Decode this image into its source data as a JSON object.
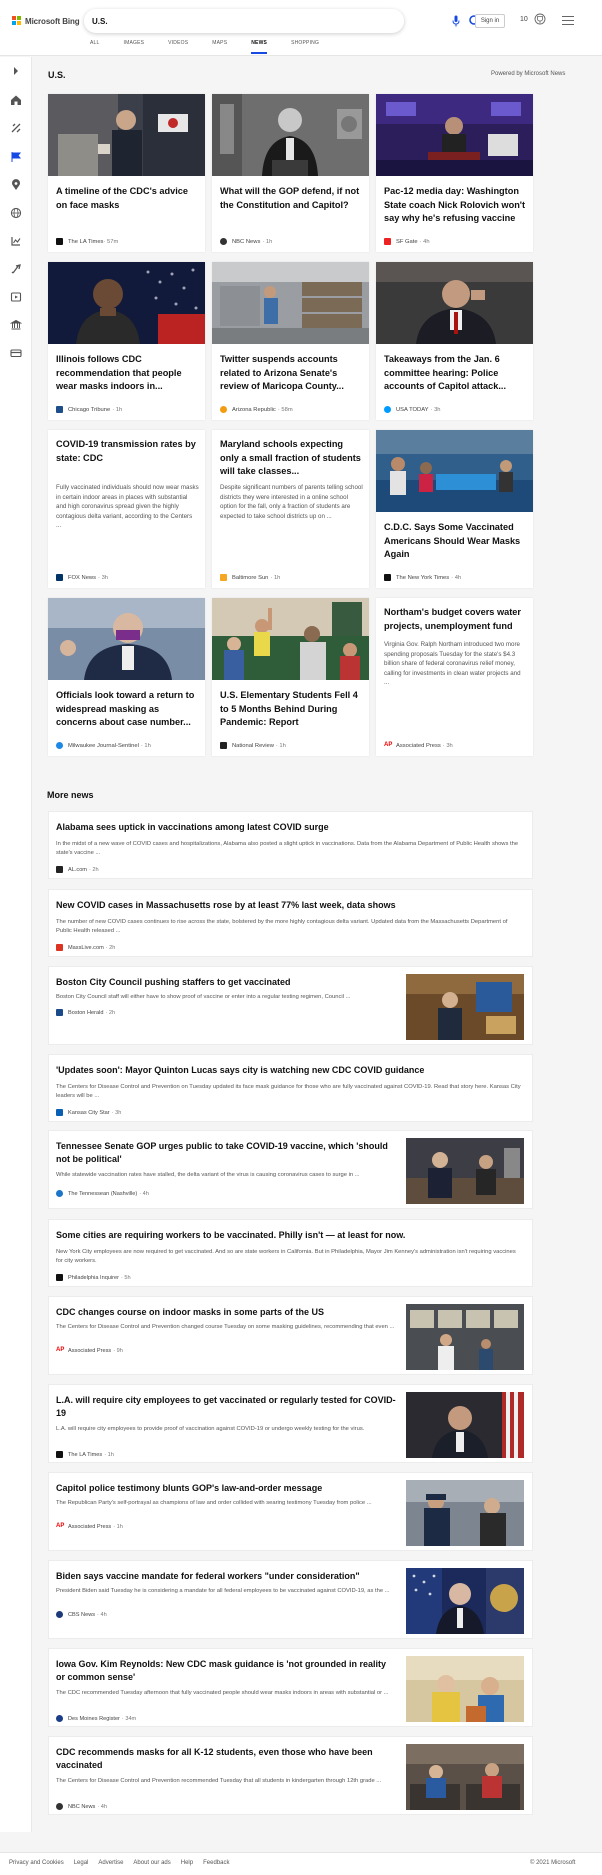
{
  "brand": {
    "name": "Microsoft Bing",
    "colors": [
      "#f25022",
      "#7fba00",
      "#00a4ef",
      "#ffb900"
    ]
  },
  "search": {
    "query": "U.S.",
    "accent": "#174ae4"
  },
  "header": {
    "signin_label": "Sign in",
    "rewards_count": "10"
  },
  "tabs": [
    {
      "label": "ALL"
    },
    {
      "label": "IMAGES"
    },
    {
      "label": "VIDEOS"
    },
    {
      "label": "MAPS"
    },
    {
      "label": "NEWS",
      "active": true
    },
    {
      "label": "SHOPPING"
    }
  ],
  "sidebar": {
    "icons": [
      "expand-icon",
      "home-icon",
      "sports-icon",
      "flag-icon",
      "location-icon",
      "globe-icon",
      "business-icon",
      "science-icon",
      "entertainment-icon",
      "politics-icon",
      "money-icon"
    ]
  },
  "section": {
    "title": "U.S.",
    "powered_by": "Powered by Microsoft News"
  },
  "cards": [
    {
      "title": "A timeline of the CDC's advice on face masks",
      "source": "The LA Times",
      "time": "57m"
    },
    {
      "title": "What will the GOP defend, if not the Constitution and Capitol?",
      "source": "NBC News",
      "time": "1h"
    },
    {
      "title": "Pac-12 media day: Washington State coach Nick Rolovich won't say why he's refusing vaccine",
      "source": "SF Gate",
      "time": "4h"
    },
    {
      "title": "Illinois follows CDC recommendation that people wear masks indoors in...",
      "source": "Chicago Tribune",
      "time": "1h"
    },
    {
      "title": "Twitter suspends accounts related to Arizona Senate's review of Maricopa County...",
      "source": "Arizona Republic",
      "time": "58m"
    },
    {
      "title": "Takeaways from the Jan. 6 committee hearing: Police accounts of Capitol attack...",
      "source": "USA TODAY",
      "time": "3h"
    },
    {
      "title": "COVID-19 transmission rates by state: CDC",
      "snippet": "Fully vaccinated individuals should now wear masks in certain indoor areas in places with substantial and high coronavirus spread given the highly contagious delta variant, according to the Centers ...",
      "source": "FOX News",
      "time": "3h"
    },
    {
      "title": "Maryland schools expecting only a small fraction of students will take classes...",
      "snippet": "Despite significant numbers of parents telling school districts they were interested in a online school option for the fall, only a fraction of students are expected to take school districts up on ...",
      "source": "Baltimore Sun",
      "time": "1h"
    },
    {
      "title": "C.D.C. Says Some Vaccinated Americans Should Wear Masks Again",
      "source": "The New York Times",
      "time": "4h"
    },
    {
      "title": "Officials look toward a return to widespread masking as concerns about case number...",
      "source": "Milwaukee Journal-Sentinel",
      "time": "1h"
    },
    {
      "title": "U.S. Elementary Students Fell 4 to 5 Months Behind During Pandemic: Report",
      "source": "National Review",
      "time": "1h"
    },
    {
      "title": "Northam's budget covers water projects, unemployment fund",
      "snippet": "Virginia Gov. Ralph Northam introduced two more spending proposals Tuesday for the state's $4.3 billion share of federal coronavirus relief money, calling for investments in clean water projects and ...",
      "source": "Associated Press",
      "time": "3h"
    }
  ],
  "more_news_title": "More news",
  "more_news": [
    {
      "title": "Alabama sees uptick in vaccinations among latest COVID surge",
      "snippet": "In the midst of a new wave of COVID cases and hospitalizations, Alabama also posted a slight uptick in vaccinations. Data from the Alabama Department of Public Health shows the state's vaccine ...",
      "source": "AL.com",
      "time": "2h"
    },
    {
      "title": "New COVID cases in Massachusetts rose by at least 77% last week, data shows",
      "snippet": "The number of new COVID cases continues to rise across the state, bolstered by the more highly contagious delta variant. Updated data from the Massachusetts Department of Public Health released ...",
      "source": "MassLive.com",
      "time": "2h"
    },
    {
      "title": "Boston City Council pushing staffers to get vaccinated",
      "snippet": "Boston City Council staff will either have to show proof of vaccine or enter into a regular testing regimen, Council ...",
      "source": "Boston Herald",
      "time": "2h"
    },
    {
      "title": "'Updates soon': Mayor Quinton Lucas says city is watching new CDC COVID guidance",
      "snippet": "The Centers for Disease Control and Prevention on Tuesday updated its face mask guidance for those who are fully vaccinated against COVID-19. Read that story here. Kansas City leaders will be ...",
      "source": "Kansas City Star",
      "time": "3h"
    },
    {
      "title": "Tennessee Senate GOP urges public to take COVID-19 vaccine, which 'should not be political'",
      "snippet": "While statewide vaccination rates have stalled, the delta variant of the virus is causing coronavirus cases to surge in ...",
      "source": "The Tennessean (Nashville)",
      "time": "4h"
    },
    {
      "title": "Some cities are requiring workers to be vaccinated. Philly isn't — at least for now.",
      "snippet": "New York City employees are now required to get vaccinated. And so are state workers in California. But in Philadelphia, Mayor Jim Kenney's administration isn't requiring vaccines for city workers.",
      "source": "Philadelphia Inquirer",
      "time": "5h"
    },
    {
      "title": "CDC changes course on indoor masks in some parts of the US",
      "snippet": "The Centers for Disease Control and Prevention changed course Tuesday on some masking guidelines, recommending that even ...",
      "source": "Associated Press",
      "time": "9h"
    },
    {
      "title": "L.A. will require city employees to get vaccinated or regularly tested for COVID-19",
      "snippet": "L.A. will require city employees to provide proof of vaccination against COVID-19 or undergo weekly testing for the virus.",
      "source": "The LA Times",
      "time": "1h"
    },
    {
      "title": "Capitol police testimony blunts GOP's law-and-order message",
      "snippet": "The Republican Party's self-portrayal as champions of law and order collided with searing testimony Tuesday from police ...",
      "source": "Associated Press",
      "time": "1h"
    },
    {
      "title": "Biden says vaccine mandate for federal workers \"under consideration\"",
      "snippet": "President Biden said Tuesday he is considering a mandate for all federal employees to be vaccinated against COVID-19, as the ...",
      "source": "CBS News",
      "time": "4h"
    },
    {
      "title": "Iowa Gov. Kim Reynolds: New CDC mask guidance is 'not grounded in reality or common sense'",
      "snippet": "The CDC recommended Tuesday afternoon that fully vaccinated people should wear masks indoors in areas with substantial or ...",
      "source": "Des Moines Register",
      "time": "34m"
    },
    {
      "title": "CDC recommends masks for all K-12 students, even those who have been vaccinated",
      "snippet": "The Centers for Disease Control and Prevention recommended Tuesday that all students in kindergarten through 12th grade ...",
      "source": "NBC News",
      "time": "4h"
    }
  ],
  "footer": {
    "links": [
      "Privacy and Cookies",
      "Legal",
      "Advertise",
      "About our ads",
      "Help",
      "Feedback"
    ],
    "copyright": "© 2021 Microsoft"
  }
}
